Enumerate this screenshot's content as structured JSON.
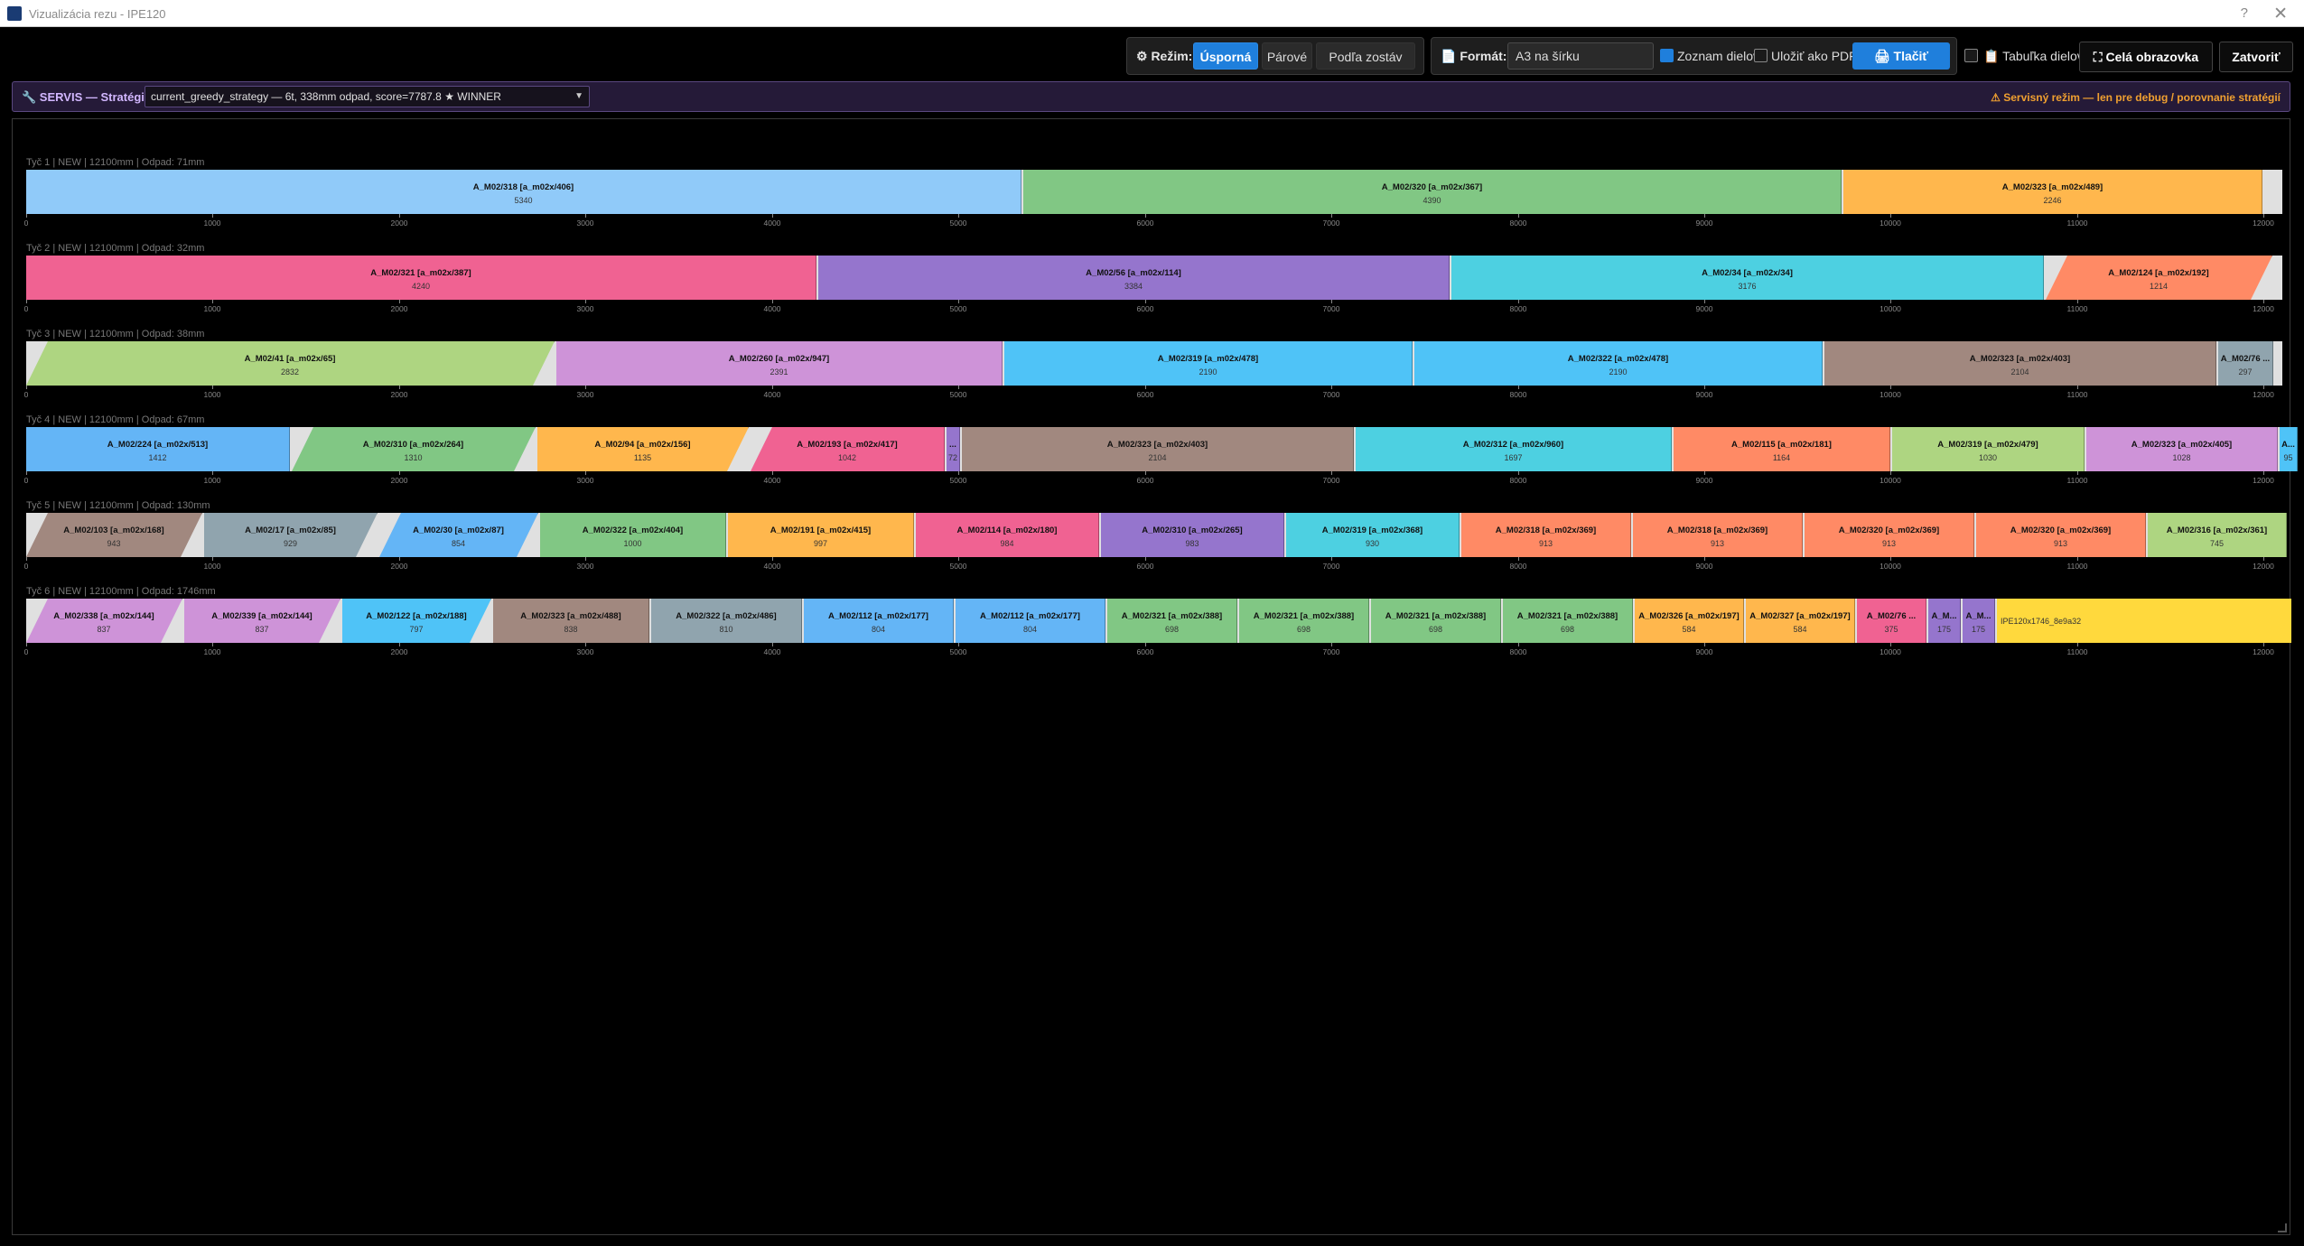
{
  "window": {
    "title": "Vizualizácia rezu - IPE120",
    "help": "?",
    "close": "✕"
  },
  "toolbar": {
    "mode_label": "⚙ Režim:",
    "modes": [
      "Úsporná",
      "Párové",
      "Podľa zostáv"
    ],
    "format_label": "📄 Formát:",
    "format_value": "A3 na šírku",
    "list_label": "Zoznam dielov",
    "list_checked": true,
    "pdf_label": "Uložiť ako PDF",
    "pdf_checked": false,
    "print_label": "🖨 Tlačiť",
    "table_label": "📋 Tabuľka dielov",
    "table_checked": false,
    "fullscreen_label": "⛶ Celá obrazovka",
    "close_label": "Zatvoriť"
  },
  "servis": {
    "label": "🔧 SERVIS — Stratégia:",
    "strategy": "current_greedy_strategy — 6t, 338mm odpad, score=7787.8 ★ WINNER",
    "warning": "⚠ Servisný režim — len pre debug / porovnanie stratégií"
  },
  "colors": {
    "light_blue": "#90caf9",
    "green": "#81c784",
    "orange": "#ffb74d",
    "pink": "#f06292",
    "purple": "#9575cd",
    "cyan": "#4dd0e1",
    "salmon": "#ff8a65",
    "lime": "#aed581",
    "lavender": "#ce93d8",
    "sky": "#4fc3f7",
    "brown": "#a1887f",
    "slate": "#90a4ae",
    "blue": "#64b5f6",
    "waste": "#e0e0e0",
    "rest": "#ffd93d"
  },
  "scale": {
    "max_mm": 12100,
    "ticks": [
      "0",
      "1000",
      "2000",
      "3000",
      "4000",
      "5000",
      "6000",
      "7000",
      "8000",
      "9000",
      "10000",
      "11000",
      "12000"
    ]
  },
  "bars": [
    {
      "header": "Tyč 1 | NEW | 12100mm | Odpad: 71mm",
      "pieces": [
        {
          "name": "A_M02/318 [a_m02x/406]",
          "len": "5340",
          "mm": 5340,
          "color": "#90caf9"
        },
        {
          "name": "A_M02/320 [a_m02x/367]",
          "len": "4390",
          "mm": 4390,
          "color": "#81c784"
        },
        {
          "name": "A_M02/323 [a_m02x/489]",
          "len": "2246",
          "mm": 2246,
          "color": "#ffb74d"
        }
      ]
    },
    {
      "header": "Tyč 2 | NEW | 12100mm | Odpad: 32mm",
      "pieces": [
        {
          "name": "A_M02/321 [a_m02x/387]",
          "len": "4240",
          "mm": 4240,
          "color": "#f06292"
        },
        {
          "name": "A_M02/56 [a_m02x/114]",
          "len": "3384",
          "mm": 3384,
          "color": "#9575cd"
        },
        {
          "name": "A_M02/34 [a_m02x/34]",
          "len": "3176",
          "mm": 3176,
          "color": "#4dd0e1"
        },
        {
          "name": "A_M02/124 [a_m02x/192]",
          "len": "1214",
          "mm": 1214,
          "color": "#ff8a65",
          "lcut": true,
          "rcut": true
        }
      ]
    },
    {
      "header": "Tyč 3 | NEW | 12100mm | Odpad: 38mm",
      "pieces": [
        {
          "name": "A_M02/41 [a_m02x/65]",
          "len": "2832",
          "mm": 2832,
          "color": "#aed581",
          "lcut": true,
          "rcut": true
        },
        {
          "name": "A_M02/260 [a_m02x/947]",
          "len": "2391",
          "mm": 2391,
          "color": "#ce93d8"
        },
        {
          "name": "A_M02/319 [a_m02x/478]",
          "len": "2190",
          "mm": 2190,
          "color": "#4fc3f7"
        },
        {
          "name": "A_M02/322 [a_m02x/478]",
          "len": "2190",
          "mm": 2190,
          "color": "#4fc3f7"
        },
        {
          "name": "A_M02/323 [a_m02x/403]",
          "len": "2104",
          "mm": 2104,
          "color": "#a1887f"
        },
        {
          "name": "A_M02/76 ...",
          "len": "297",
          "mm": 297,
          "color": "#90a4ae"
        }
      ]
    },
    {
      "header": "Tyč 4 | NEW | 12100mm | Odpad: 67mm",
      "pieces": [
        {
          "name": "A_M02/224 [a_m02x/513]",
          "len": "1412",
          "mm": 1412,
          "color": "#64b5f6"
        },
        {
          "name": "A_M02/310 [a_m02x/264]",
          "len": "1310",
          "mm": 1310,
          "color": "#81c784",
          "lcut": true,
          "rcut": true
        },
        {
          "name": "A_M02/94 [a_m02x/156]",
          "len": "1135",
          "mm": 1135,
          "color": "#ffb74d",
          "rcut": true
        },
        {
          "name": "A_M02/193 [a_m02x/417]",
          "len": "1042",
          "mm": 1042,
          "color": "#f06292",
          "lcut": true
        },
        {
          "name": "...",
          "len": "72",
          "mm": 72,
          "color": "#9575cd"
        },
        {
          "name": "A_M02/323 [a_m02x/403]",
          "len": "2104",
          "mm": 2104,
          "color": "#a1887f"
        },
        {
          "name": "A_M02/312 [a_m02x/960]",
          "len": "1697",
          "mm": 1697,
          "color": "#4dd0e1"
        },
        {
          "name": "A_M02/115 [a_m02x/181]",
          "len": "1164",
          "mm": 1164,
          "color": "#ff8a65"
        },
        {
          "name": "A_M02/319 [a_m02x/479]",
          "len": "1030",
          "mm": 1030,
          "color": "#aed581"
        },
        {
          "name": "A_M02/323 [a_m02x/405]",
          "len": "1028",
          "mm": 1028,
          "color": "#ce93d8"
        },
        {
          "name": "A...",
          "len": "95",
          "mm": 95,
          "color": "#4fc3f7"
        }
      ]
    },
    {
      "header": "Tyč 5 | NEW | 12100mm | Odpad: 130mm",
      "pieces": [
        {
          "name": "A_M02/103 [a_m02x/168]",
          "len": "943",
          "mm": 943,
          "color": "#a1887f",
          "lcut": true,
          "rcut": true
        },
        {
          "name": "A_M02/17 [a_m02x/85]",
          "len": "929",
          "mm": 929,
          "color": "#90a4ae",
          "rcut": true
        },
        {
          "name": "A_M02/30 [a_m02x/87]",
          "len": "854",
          "mm": 854,
          "color": "#64b5f6",
          "lcut": true,
          "rcut": true
        },
        {
          "name": "A_M02/322 [a_m02x/404]",
          "len": "1000",
          "mm": 1000,
          "color": "#81c784"
        },
        {
          "name": "A_M02/191 [a_m02x/415]",
          "len": "997",
          "mm": 997,
          "color": "#ffb74d"
        },
        {
          "name": "A_M02/114 [a_m02x/180]",
          "len": "984",
          "mm": 984,
          "color": "#f06292"
        },
        {
          "name": "A_M02/310 [a_m02x/265]",
          "len": "983",
          "mm": 983,
          "color": "#9575cd"
        },
        {
          "name": "A_M02/319 [a_m02x/368]",
          "len": "930",
          "mm": 930,
          "color": "#4dd0e1"
        },
        {
          "name": "A_M02/318 [a_m02x/369]",
          "len": "913",
          "mm": 913,
          "color": "#ff8a65"
        },
        {
          "name": "A_M02/318 [a_m02x/369]",
          "len": "913",
          "mm": 913,
          "color": "#ff8a65"
        },
        {
          "name": "A_M02/320 [a_m02x/369]",
          "len": "913",
          "mm": 913,
          "color": "#ff8a65"
        },
        {
          "name": "A_M02/320 [a_m02x/369]",
          "len": "913",
          "mm": 913,
          "color": "#ff8a65"
        },
        {
          "name": "A_M02/316 [a_m02x/361]",
          "len": "745",
          "mm": 745,
          "color": "#aed581"
        }
      ]
    },
    {
      "header": "Tyč 6 | NEW | 12100mm | Odpad: 1746mm",
      "pieces": [
        {
          "name": "A_M02/338 [a_m02x/144]",
          "len": "837",
          "mm": 837,
          "color": "#ce93d8",
          "lcut": true,
          "rcut": true
        },
        {
          "name": "A_M02/339 [a_m02x/144]",
          "len": "837",
          "mm": 837,
          "color": "#ce93d8",
          "rcut": true
        },
        {
          "name": "A_M02/122 [a_m02x/188]",
          "len": "797",
          "mm": 797,
          "color": "#4fc3f7",
          "rcut": true
        },
        {
          "name": "A_M02/323 [a_m02x/488]",
          "len": "838",
          "mm": 838,
          "color": "#a1887f"
        },
        {
          "name": "A_M02/322 [a_m02x/486]",
          "len": "810",
          "mm": 810,
          "color": "#90a4ae"
        },
        {
          "name": "A_M02/112 [a_m02x/177]",
          "len": "804",
          "mm": 804,
          "color": "#64b5f6"
        },
        {
          "name": "A_M02/112 [a_m02x/177]",
          "len": "804",
          "mm": 804,
          "color": "#64b5f6"
        },
        {
          "name": "A_M02/321 [a_m02x/388]",
          "len": "698",
          "mm": 698,
          "color": "#81c784"
        },
        {
          "name": "A_M02/321 [a_m02x/388]",
          "len": "698",
          "mm": 698,
          "color": "#81c784"
        },
        {
          "name": "A_M02/321 [a_m02x/388]",
          "len": "698",
          "mm": 698,
          "color": "#81c784"
        },
        {
          "name": "A_M02/321 [a_m02x/388]",
          "len": "698",
          "mm": 698,
          "color": "#81c784"
        },
        {
          "name": "A_M02/326 [a_m02x/197]",
          "len": "584",
          "mm": 584,
          "color": "#ffb74d"
        },
        {
          "name": "A_M02/327 [a_m02x/197]",
          "len": "584",
          "mm": 584,
          "color": "#ffb74d"
        },
        {
          "name": "A_M02/76 ...",
          "len": "375",
          "mm": 375,
          "color": "#f06292"
        },
        {
          "name": "A_M...",
          "len": "175",
          "mm": 175,
          "color": "#9575cd"
        },
        {
          "name": "A_M...",
          "len": "175",
          "mm": 175,
          "color": "#9575cd"
        }
      ],
      "rest": {
        "label": "IPE120x1746_8e9a32",
        "mm": 1746
      }
    }
  ]
}
